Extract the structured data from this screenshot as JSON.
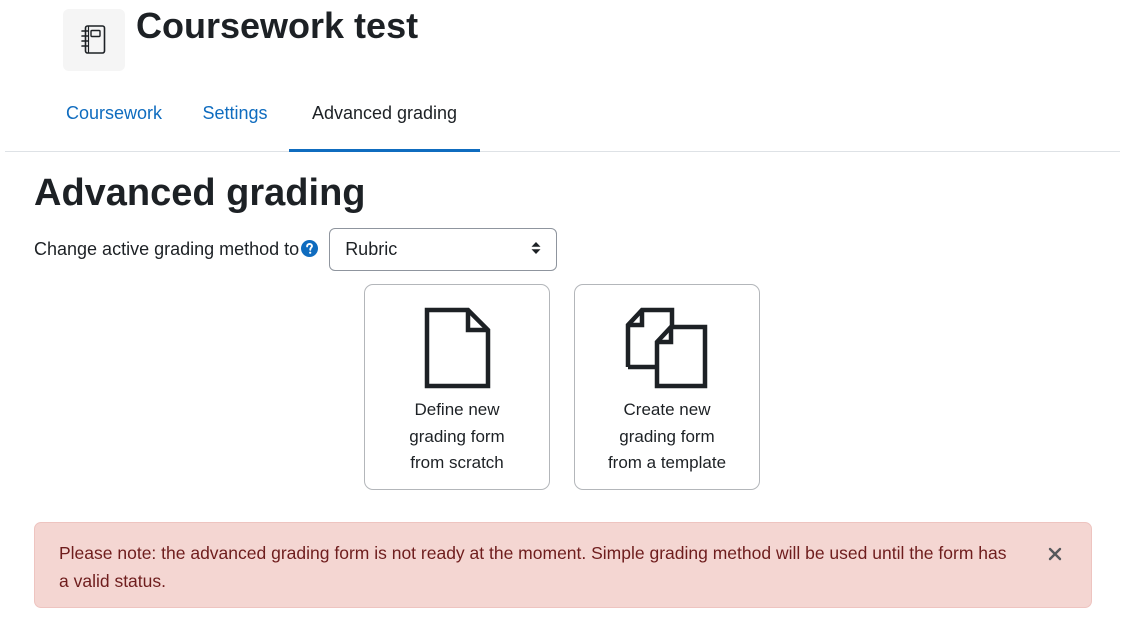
{
  "header": {
    "activity_icon": "notebook-icon",
    "title": "Coursework test"
  },
  "tabs": [
    {
      "label": "Coursework",
      "active": false
    },
    {
      "label": "Settings",
      "active": false
    },
    {
      "label": "Advanced grading",
      "active": true
    }
  ],
  "main": {
    "heading": "Advanced grading",
    "method_label": "Change active grading method to",
    "help_icon": "question-circle-icon",
    "method_select": {
      "selected": "Rubric",
      "icon": "sort-arrows-icon"
    },
    "cards": [
      {
        "icon": "blank-file-icon",
        "lines": [
          "Define new",
          "grading form",
          "from scratch"
        ]
      },
      {
        "icon": "copy-files-icon",
        "lines": [
          "Create new",
          "grading form",
          "from a template"
        ]
      }
    ]
  },
  "alert": {
    "text": "Please note: the advanced grading form is not ready at the moment. Simple grading method will be used until the form has a valid status.",
    "close_icon": "close-icon"
  },
  "colors": {
    "link": "#0f6cbf",
    "text": "#1d2125",
    "alert_bg": "#f4d6d2",
    "alert_text": "#6e1d1d",
    "help": "#0f6cbf"
  }
}
